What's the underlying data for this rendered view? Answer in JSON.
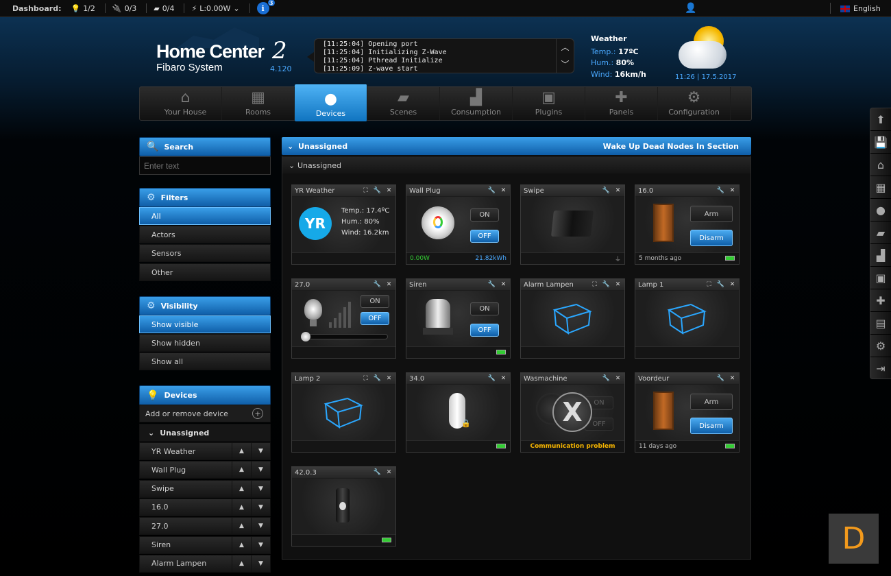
{
  "topbar": {
    "dashboard_label": "Dashboard:",
    "lights": "1/2",
    "plugs": "0/3",
    "blinds": "0/4",
    "power": "L:0.00W",
    "info_count": "3",
    "language": "English",
    "lang_flag": "uk-flag-icon"
  },
  "logo": {
    "line1": "Home Center",
    "mark": "2",
    "line2": "Fibaro System",
    "version": "4.120"
  },
  "log": {
    "lines": [
      "[11:25:04] Opening port",
      "[11:25:04] Initializing Z-Wave",
      "[11:25:04] Pthread Initialize",
      "[11:25:09] Z-wave start"
    ]
  },
  "weather": {
    "title": "Weather",
    "temp_label": "Temp.:",
    "temp": "17ºC",
    "hum_label": "Hum.:",
    "hum": "80%",
    "wind_label": "Wind:",
    "wind": "16km/h",
    "time": "11:26",
    "date": "17.5.2017"
  },
  "nav": [
    {
      "label": "Your House",
      "icon": "house-icon"
    },
    {
      "label": "Rooms",
      "icon": "rooms-icon"
    },
    {
      "label": "Devices",
      "icon": "bulb-icon",
      "active": true
    },
    {
      "label": "Scenes",
      "icon": "clapper-icon"
    },
    {
      "label": "Consumption",
      "icon": "chart-icon"
    },
    {
      "label": "Plugins",
      "icon": "box-icon"
    },
    {
      "label": "Panels",
      "icon": "puzzle-icon"
    },
    {
      "label": "Configuration",
      "icon": "gears-icon"
    }
  ],
  "search": {
    "title": "Search",
    "placeholder": "Enter text"
  },
  "filters": {
    "title": "Filters",
    "items": [
      "All",
      "Actors",
      "Sensors",
      "Other"
    ],
    "selected": "All"
  },
  "visibility": {
    "title": "Visibility",
    "items": [
      "Show visible",
      "Show hidden",
      "Show all"
    ],
    "selected": "Show visible"
  },
  "devices_panel": {
    "title": "Devices",
    "add_remove": "Add or remove device",
    "section": "Unassigned",
    "items": [
      "YR Weather",
      "Wall Plug",
      "Swipe",
      "16.0",
      "27.0",
      "Siren",
      "Alarm Lampen"
    ]
  },
  "main": {
    "header": "Unassigned",
    "wake_up": "Wake Up Dead Nodes In Section",
    "subheader": "Unassigned"
  },
  "cards": [
    {
      "title": "YR Weather",
      "logo": "YR",
      "temp": "Temp.: 17.4ºC",
      "hum": "Hum.: 80%",
      "wind": "Wind: 16.2km"
    },
    {
      "title": "Wall Plug",
      "on": "ON",
      "off": "OFF",
      "power": "0.00W",
      "energy": "21.82kWh"
    },
    {
      "title": "Swipe"
    },
    {
      "title": "16.0",
      "arm": "Arm",
      "disarm": "Disarm",
      "ago": "5 months ago"
    },
    {
      "title": "27.0",
      "on": "ON",
      "off": "OFF",
      "dimmer": 0
    },
    {
      "title": "Siren",
      "on": "ON",
      "off": "OFF"
    },
    {
      "title": "Alarm Lampen"
    },
    {
      "title": "Lamp 1"
    },
    {
      "title": "Lamp 2"
    },
    {
      "title": "34.0"
    },
    {
      "title": "Wasmachine",
      "problem": "Communication problem",
      "on": "ON",
      "off": "OFF"
    },
    {
      "title": "Voordeur",
      "arm": "Arm",
      "disarm": "Disarm",
      "ago": "11 days ago"
    },
    {
      "title": "42.0.3"
    }
  ],
  "corner_logo": "D"
}
